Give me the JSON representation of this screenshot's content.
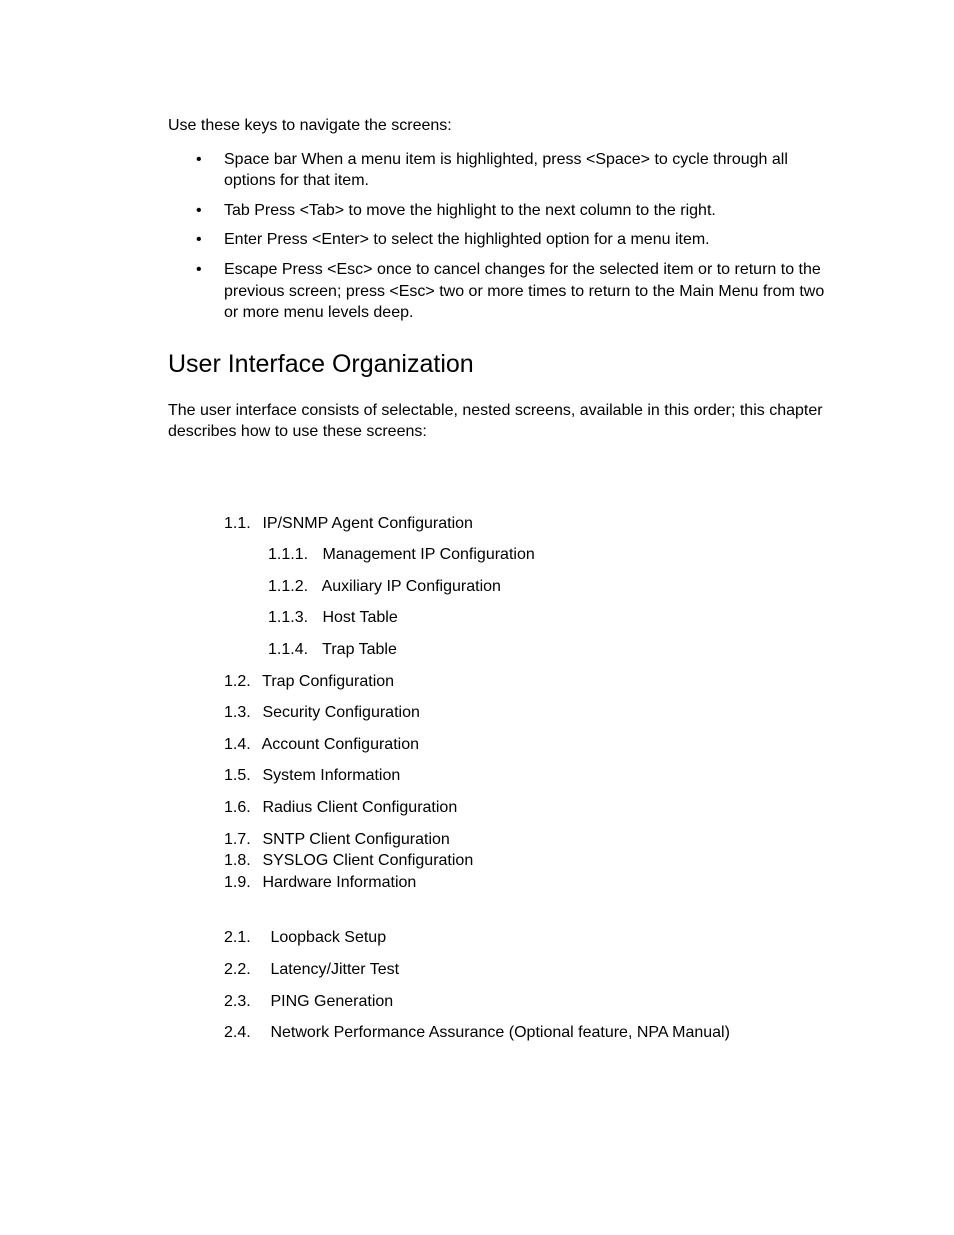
{
  "intro": "Use these keys to navigate the screens:",
  "keys": [
    "Space bar  When a menu item is highlighted, press <Space> to cycle through all options for that item.",
    "Tab  Press <Tab> to move the highlight to the next column to the right.",
    "Enter  Press <Enter> to select the highlighted option for a menu item.",
    "Escape  Press <Esc> once to cancel changes for the selected item or to return to the previous screen; press <Esc> two or more times to return to the Main Menu from two or more menu levels deep."
  ],
  "section_heading": "User Interface Organization",
  "section_intro": "The user interface consists of selectable, nested screens, available in this order; this chapter describes how to use these screens:",
  "outline": {
    "g1": {
      "n11": {
        "num": "1.1.",
        "label": "IP/SNMP Agent Configuration"
      },
      "n111": {
        "num": "1.1.1.",
        "label": "Management IP Configuration"
      },
      "n112": {
        "num": "1.1.2.",
        "label": "Auxiliary IP Configuration"
      },
      "n113": {
        "num": "1.1.3.",
        "label": "Host Table"
      },
      "n114": {
        "num": "1.1.4.",
        "label": "Trap Table"
      },
      "n12": {
        "num": "1.2.",
        "label": "Trap Configuration"
      },
      "n13": {
        "num": "1.3.",
        "label": "Security Configuration"
      },
      "n14": {
        "num": "1.4.",
        "label": "Account Configuration"
      },
      "n15": {
        "num": "1.5.",
        "label": "System Information"
      },
      "n16": {
        "num": "1.6.",
        "label": "Radius Client Configuration"
      },
      "n17": {
        "num": "1.7.",
        "label": "SNTP Client Configuration"
      },
      "n18": {
        "num": "1.8.",
        "label": "SYSLOG Client Configuration"
      },
      "n19": {
        "num": "1.9.",
        "label": "Hardware Information"
      }
    },
    "g2": {
      "n21": {
        "num": "2.1.",
        "label": "Loopback Setup"
      },
      "n22": {
        "num": "2.2.",
        "label": "Latency/Jitter Test"
      },
      "n23": {
        "num": "2.3.",
        "label": "PING Generation"
      },
      "n24": {
        "num": "2.4.",
        "label": "Network Performance Assurance (Optional feature, NPA Manual)"
      }
    }
  }
}
